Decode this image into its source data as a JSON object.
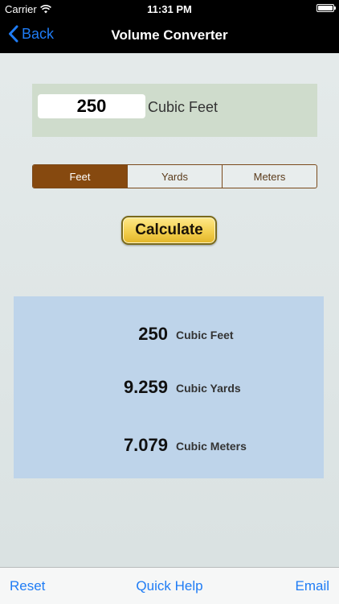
{
  "status_bar": {
    "carrier": "Carrier",
    "time": "11:31 PM",
    "wifi_icon": "wifi-icon",
    "battery_icon": "battery-icon"
  },
  "nav": {
    "back_label": "Back",
    "back_icon": "chevron-left-icon",
    "title": "Volume Converter",
    "accent_color": "#1f7cf5"
  },
  "input": {
    "value": "250",
    "unit_label": "Cubic Feet"
  },
  "segments": {
    "items": [
      {
        "label": "Feet",
        "selected": true
      },
      {
        "label": "Yards",
        "selected": false
      },
      {
        "label": "Meters",
        "selected": false
      }
    ],
    "selected_color": "#86490f"
  },
  "calculate_label": "Calculate",
  "results": [
    {
      "value": "250",
      "unit": "Cubic Feet"
    },
    {
      "value": "9.259",
      "unit": "Cubic Yards"
    },
    {
      "value": "7.079",
      "unit": "Cubic Meters"
    }
  ],
  "toolbar": {
    "reset_label": "Reset",
    "help_label": "Quick Help",
    "email_label": "Email"
  }
}
